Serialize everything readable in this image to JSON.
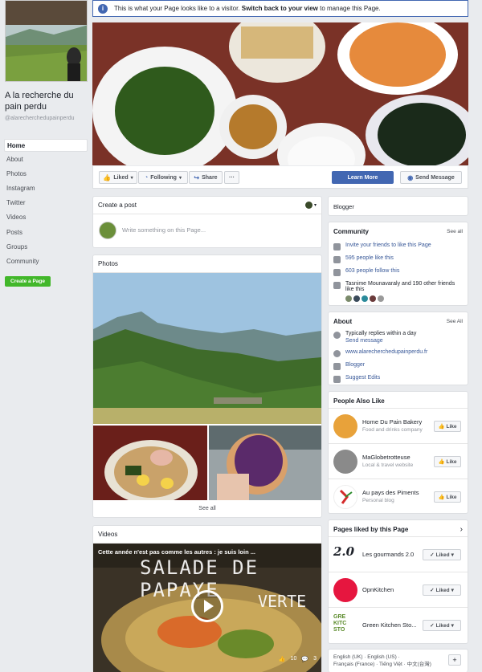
{
  "banner": {
    "text": "This is what your Page looks like to a visitor.",
    "link": "Switch back to your view",
    "suffix": " to manage this Page."
  },
  "sidebar": {
    "page_name": "A la recherche du pain perdu",
    "handle": "@alarecherchedupainperdu",
    "items": [
      {
        "label": "Home"
      },
      {
        "label": "About"
      },
      {
        "label": "Photos"
      },
      {
        "label": "Instagram"
      },
      {
        "label": "Twitter"
      },
      {
        "label": "Videos"
      },
      {
        "label": "Posts"
      },
      {
        "label": "Groups"
      },
      {
        "label": "Community"
      }
    ],
    "create_page": "Create a Page"
  },
  "actions": {
    "liked": "Liked",
    "following": "Following",
    "share": "Share",
    "more": "···",
    "learn_more": "Learn More",
    "send_message": "Send Message"
  },
  "create_post": {
    "title": "Create a post",
    "placeholder": "Write something on this Page..."
  },
  "photos": {
    "title": "Photos",
    "see_all": "See all"
  },
  "videos": {
    "title": "Videos",
    "video_title": "Cette année n'est pas comme les autres : je suis loin ...",
    "overlay_line1": "SALADE DE PAPAYE",
    "overlay_line2": "VERTE",
    "likes": "10",
    "comments": "3"
  },
  "right": {
    "category": "Blogger",
    "community": {
      "title": "Community",
      "see_all": "See all",
      "invite": "Invite your friends to like this Page",
      "likes": "595 people like this",
      "follows": "603 people follow this",
      "friends": "Tasnime Mounavaraly and 190 other friends like this"
    },
    "about": {
      "title": "About",
      "see_all": "See All",
      "replies": "Typically replies within a day",
      "send_message": "Send message",
      "website": "www.alarecherchedupainperdu.fr",
      "category": "Blogger",
      "suggest": "Suggest Edits"
    },
    "people_also_like": {
      "title": "People Also Like",
      "items": [
        {
          "name": "Home Du Pain Bakery",
          "sub": "Food and drinks company",
          "btn": "Like"
        },
        {
          "name": "MaGlobetrotteuse",
          "sub": "Local & travel website",
          "btn": "Like"
        },
        {
          "name": "Au pays des Piments",
          "sub": "Personal blog",
          "btn": "Like"
        }
      ]
    },
    "pages_liked": {
      "title": "Pages liked by this Page",
      "items": [
        {
          "name": "Les gourmands 2.0",
          "logo": "2.0",
          "btn": "Liked"
        },
        {
          "name": "OpnKitchen",
          "btn": "Liked"
        },
        {
          "name": "Green Kitchen Sto...",
          "logo": "GRE KITC STO",
          "btn": "Liked"
        }
      ]
    },
    "languages": {
      "line1": "English (UK) · English (US) ·",
      "line2": "Français (France) · Tiếng Việt · 中文(台灣)",
      "add": "+"
    }
  }
}
